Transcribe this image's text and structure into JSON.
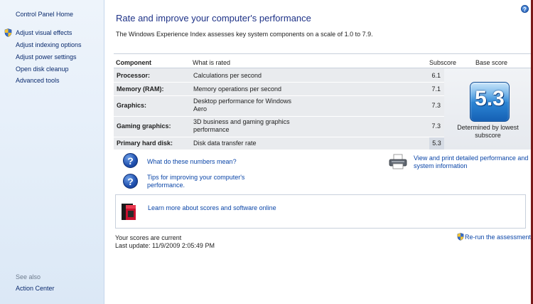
{
  "nav": {
    "home": "Control Panel Home",
    "items": [
      {
        "label": "Adjust visual effects",
        "shield": true
      },
      {
        "label": "Adjust indexing options",
        "shield": false
      },
      {
        "label": "Adjust power settings",
        "shield": false
      },
      {
        "label": "Open disk cleanup",
        "shield": false
      },
      {
        "label": "Advanced tools",
        "shield": false
      }
    ],
    "see_also": "See also",
    "action_center": "Action Center"
  },
  "main": {
    "help": "?",
    "title": "Rate and improve your computer's performance",
    "description": "The Windows Experience Index assesses key system components on a scale of 1.0 to 7.9."
  },
  "table": {
    "headers": {
      "component": "Component",
      "rated": "What is rated",
      "subscore": "Subscore",
      "base": "Base score"
    },
    "rows": [
      {
        "component": "Processor:",
        "rated": "Calculations per second",
        "subscore": "6.1"
      },
      {
        "component": "Memory (RAM):",
        "rated": "Memory operations per second",
        "subscore": "7.1"
      },
      {
        "component": "Graphics:",
        "rated": "Desktop performance for Windows Aero",
        "subscore": "7.3"
      },
      {
        "component": "Gaming graphics:",
        "rated": "3D business and gaming graphics performance",
        "subscore": "7.3"
      },
      {
        "component": "Primary hard disk:",
        "rated": "Disk data transfer rate",
        "subscore": "5.3"
      }
    ],
    "base_score": "5.3",
    "determined": "Determined by lowest subscore"
  },
  "links": {
    "numbers_mean": "What do these numbers mean?",
    "tips": "Tips for improving your computer's performance.",
    "view_print": "View and print detailed performance and system information",
    "learn_more": "Learn more about scores and software online"
  },
  "status": {
    "current": "Your scores are current",
    "last_update": "Last update: 11/9/2009 2:05:49 PM",
    "rerun": "Re-run the assessment"
  },
  "colors": {
    "title": "#1e3287",
    "link": "#0b46a8",
    "nav_bg": "#e4eef9",
    "badge": "#2f8ad9"
  }
}
